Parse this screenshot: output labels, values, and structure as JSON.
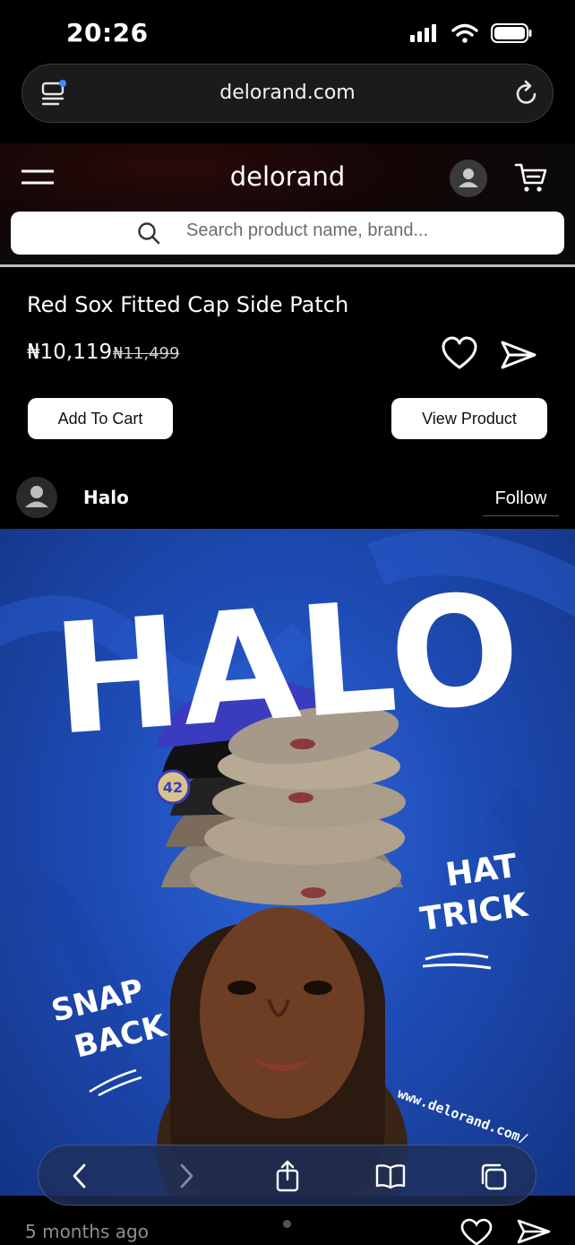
{
  "status_bar": {
    "time": "20:26"
  },
  "browser": {
    "url": "delorand.com"
  },
  "site": {
    "brand": "delorand",
    "search_placeholder": "Search product name, brand..."
  },
  "product": {
    "title": "Red Sox Fitted Cap Side Patch",
    "price": "₦10,119",
    "old_price": "₦11,499",
    "add_to_cart_label": "Add To Cart",
    "view_product_label": "View Product"
  },
  "post": {
    "author": "Halo",
    "follow_label": "Follow",
    "time_ago": "5 months ago",
    "image_text": {
      "headline": "HALO",
      "tag_right_1": "HAT",
      "tag_right_2": "TRICK",
      "tag_left_1": "SNAP",
      "tag_left_2": "BACK",
      "website": "www.delorand.com/",
      "cap_patch": "42"
    }
  },
  "colors": {
    "accent_blue": "#1e4cb6",
    "background": "#000000",
    "button_bg": "#ffffff"
  },
  "icons": [
    "tabs-icon",
    "reload-icon",
    "hamburger-icon",
    "account-icon",
    "cart-icon",
    "search-icon",
    "heart-icon",
    "share-icon",
    "back-icon",
    "forward-icon",
    "share-sheet-icon",
    "bookmarks-icon",
    "tabs-overview-icon"
  ]
}
